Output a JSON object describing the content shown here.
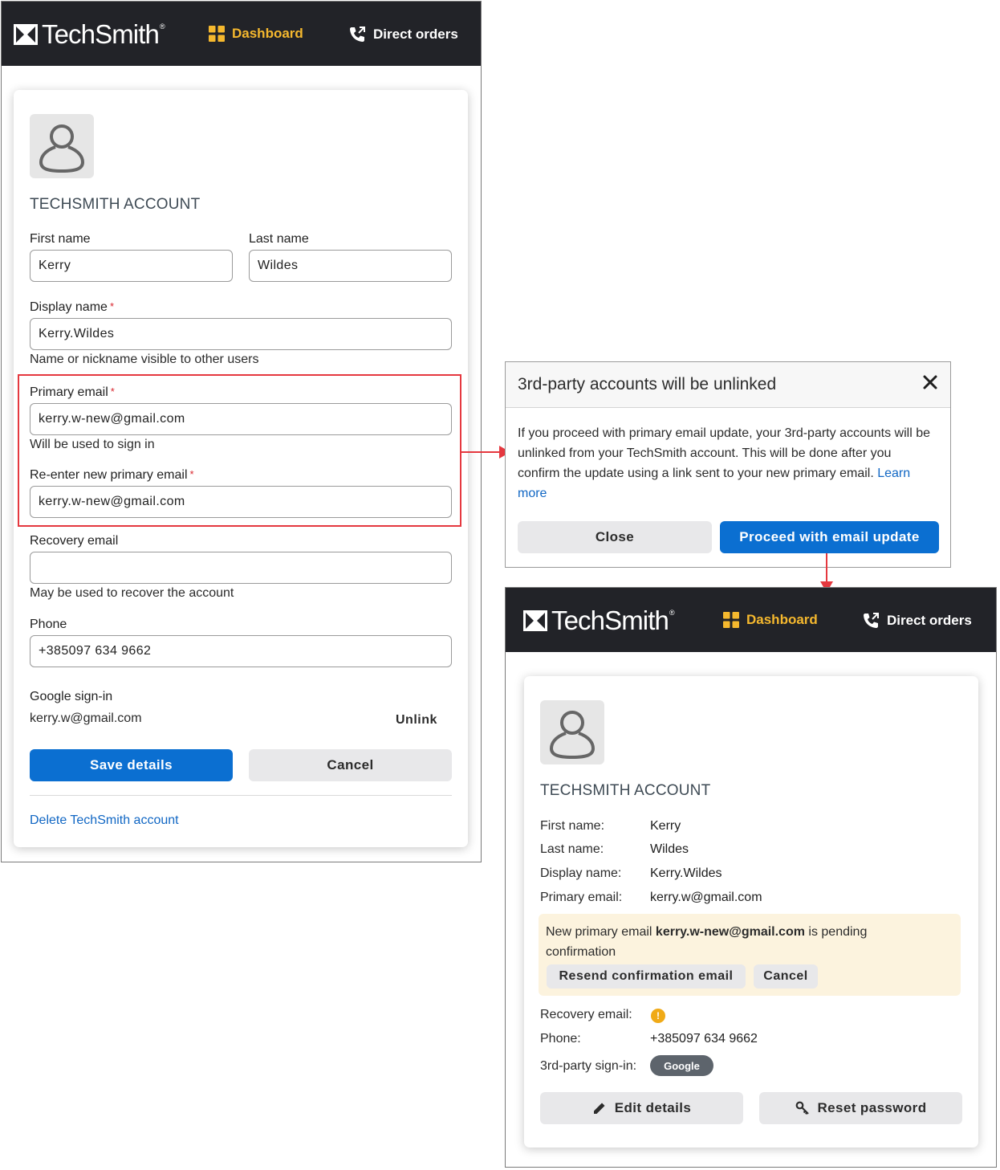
{
  "brand": {
    "name": "TechSmith",
    "reg": "®"
  },
  "nav": {
    "dashboard": "Dashboard",
    "direct_orders": "Direct orders"
  },
  "edit_form": {
    "title": "TECHSMITH ACCOUNT",
    "first_name_label": "First name",
    "first_name_value": "Kerry",
    "last_name_label": "Last name",
    "last_name_value": "Wildes",
    "display_name_label": "Display name",
    "display_name_value": "Kerry.Wildes",
    "display_name_hint": "Name or nickname visible to other users",
    "primary_email_label": "Primary email",
    "primary_email_value": "kerry.w-new@gmail.com",
    "primary_email_hint": "Will be used to sign in",
    "reenter_email_label": "Re-enter new primary email",
    "reenter_email_value": "kerry.w-new@gmail.com",
    "recovery_email_label": "Recovery email",
    "recovery_email_value": "",
    "recovery_email_hint": "May be used to recover the account",
    "phone_label": "Phone",
    "phone_value": "+385097 634 9662",
    "google_label": "Google sign-in",
    "google_email": "kerry.w@gmail.com",
    "unlink": "Unlink",
    "save": "Save details",
    "cancel": "Cancel",
    "delete": "Delete TechSmith account",
    "required_mark": "*"
  },
  "modal": {
    "title": "3rd-party accounts will be unlinked",
    "body": "If you proceed with primary email update, your 3rd-party accounts will be unlinked from your TechSmith account. This will be done after you confirm the update using a link sent to your new primary email.",
    "learn_more": "Learn more",
    "close": "Close",
    "proceed": "Proceed with email update"
  },
  "summary": {
    "title": "TECHSMITH ACCOUNT",
    "first_name_label": "First name:",
    "first_name": "Kerry",
    "last_name_label": "Last name:",
    "last_name": "Wildes",
    "display_name_label": "Display name:",
    "display_name": "Kerry.Wildes",
    "primary_email_label": "Primary email:",
    "primary_email": "kerry.w@gmail.com",
    "pending_prefix": "New primary email",
    "pending_email": "kerry.w-new@gmail.com",
    "pending_suffix": "is pending confirmation",
    "resend": "Resend confirmation email",
    "cancel": "Cancel",
    "recovery_label": "Recovery email:",
    "recovery_warning": "!",
    "phone_label": "Phone:",
    "phone": "+385097 634 9662",
    "third_party_label": "3rd-party sign-in:",
    "third_party_badge": "Google",
    "edit": "Edit details",
    "reset": "Reset password"
  },
  "colors": {
    "topbar": "#222328",
    "accent_yellow": "#f5b82e",
    "primary_blue": "#0b6fd1",
    "highlight_red": "#e5383f",
    "pending_bg": "#fcf3de"
  },
  "icons": {
    "logo": "techsmith-logo-icon",
    "dashboard": "grid-icon",
    "orders": "phone-icon",
    "avatar": "user-icon",
    "close": "close-icon",
    "edit": "pencil-icon",
    "reset": "key-icon",
    "warning": "warning-icon"
  }
}
